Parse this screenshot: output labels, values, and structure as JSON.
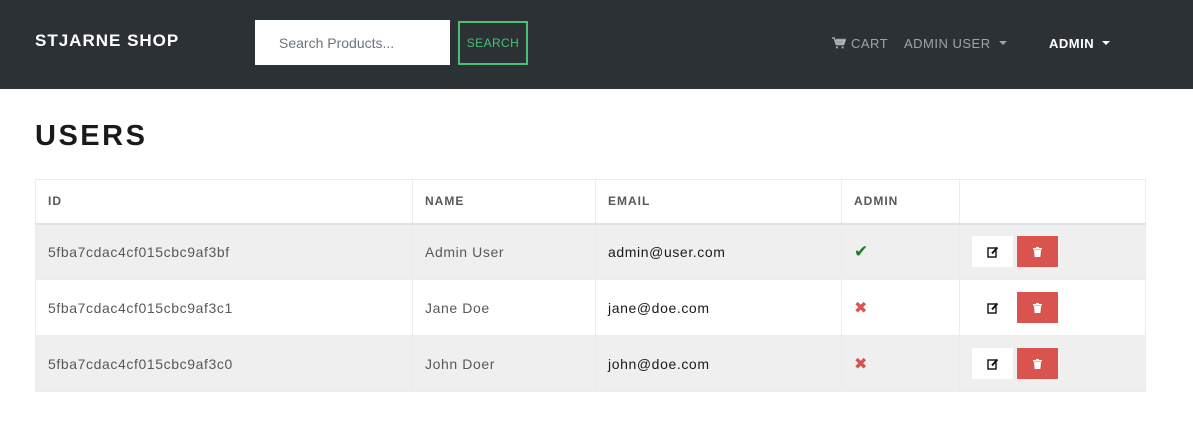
{
  "navbar": {
    "brand": "STJARNE SHOP",
    "search_placeholder": "Search Products...",
    "search_button": "SEARCH",
    "cart_label": "CART",
    "user_menu_label": "ADMIN USER",
    "admin_menu_label": "ADMIN"
  },
  "page": {
    "title": "USERS"
  },
  "table": {
    "headers": [
      "ID",
      "NAME",
      "EMAIL",
      "ADMIN",
      ""
    ],
    "rows": [
      {
        "id": "5fba7cdac4cf015cbc9af3bf",
        "name": "Admin User",
        "email": "admin@user.com",
        "admin": "✔"
      },
      {
        "id": "5fba7cdac4cf015cbc9af3c1",
        "name": "Jane Doe",
        "email": "jane@doe.com",
        "admin": "✖"
      },
      {
        "id": "5fba7cdac4cf015cbc9af3c0",
        "name": "John Doer",
        "email": "john@doe.com",
        "admin": "✖"
      }
    ]
  },
  "colors": {
    "navbar_bg": "#2c3136",
    "accent_green": "#4bbf73",
    "danger_red": "#d9534f",
    "admin_check": "#1e7e1e"
  },
  "icons": {
    "cart": "shopping-cart-icon",
    "edit": "edit-icon",
    "delete": "trash-icon",
    "admin_yes": "check-icon",
    "admin_no": "times-icon"
  }
}
